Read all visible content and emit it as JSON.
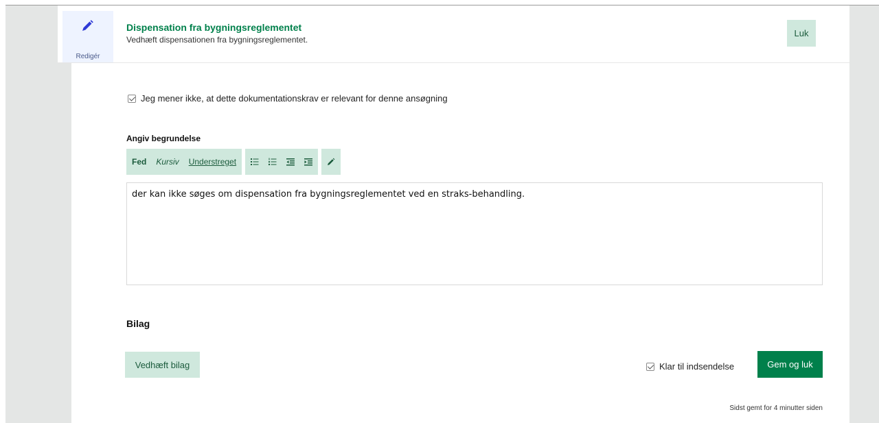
{
  "header": {
    "edit_label": "Redigér",
    "title": "Dispensation fra bygningsreglementet",
    "subtitle": "Vedhæft dispensationen fra bygningsreglementet.",
    "close_label": "Luk"
  },
  "not_relevant": {
    "label": "Jeg mener ikke, at dette dokumentationskrav er relevant for denne ansøgning",
    "checked": true
  },
  "reason": {
    "label": "Angiv begrundelse",
    "toolbar": {
      "bold": "Fed",
      "italic": "Kursiv",
      "underline": "Understreget",
      "icons": [
        "bulleted-list-icon",
        "numbered-list-icon",
        "outdent-icon",
        "indent-icon",
        "pencil-icon"
      ]
    },
    "text": "der kan ikke søges om dispensation fra bygningsreglementet ved en straks-behandling."
  },
  "attachments": {
    "heading": "Bilag",
    "attach_button": "Vedhæft bilag"
  },
  "footer": {
    "ready_label": "Klar til indsendelse",
    "ready_checked": true,
    "save_button": "Gem og luk",
    "saved_note": "Sidst gemt for 4 minutter siden"
  },
  "colors": {
    "accent_green": "#00804b",
    "light_green": "#cfe8dd",
    "gutter_gray": "#e4e6e5",
    "edit_tile_bg": "#eef3ff"
  }
}
